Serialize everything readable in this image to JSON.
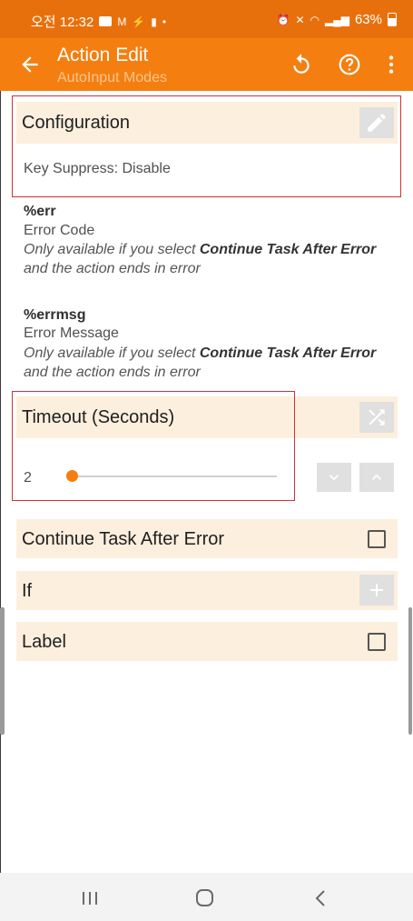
{
  "status_bar": {
    "time": "오전 12:32",
    "battery": "63%"
  },
  "toolbar": {
    "title": "Action Edit",
    "subtitle": "AutoInput Modes",
    "icons": [
      "back-arrow-icon",
      "reset-icon",
      "help-icon",
      "more-vert-icon"
    ]
  },
  "configuration": {
    "title": "Configuration",
    "value": "Key Suppress: Disable",
    "icon": "pencil-icon"
  },
  "outputs": [
    {
      "name": "%err",
      "label": "Error Code",
      "note_prefix": "Only available if you select ",
      "note_bold": "Continue Task After Error",
      "note_suffix": " and the action ends in error"
    },
    {
      "name": "%errmsg",
      "label": "Error Message",
      "note_prefix": "Only available if you select ",
      "note_bold": "Continue Task After Error",
      "note_suffix": " and the action ends in error"
    }
  ],
  "timeout": {
    "title": "Timeout (Seconds)",
    "value": "2",
    "slider_fraction": 0.0,
    "icon": "shuffle-icon"
  },
  "options": {
    "continue_after_error": "Continue Task After Error",
    "if_label": "If",
    "label_label": "Label"
  },
  "colors": {
    "statusbar": "#e8700c",
    "toolbar": "#f47f10",
    "section_bg": "#fdefde",
    "highlight_box": "#d32f3a"
  }
}
